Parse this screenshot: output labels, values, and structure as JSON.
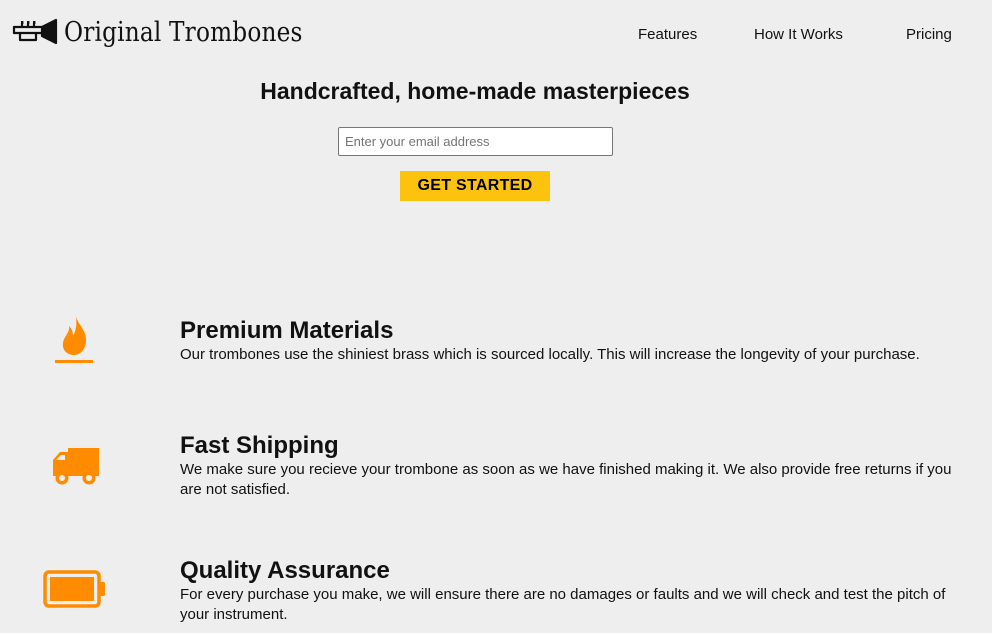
{
  "brand": {
    "name": "Original Trombones",
    "logo_icon": "trombone-icon"
  },
  "nav": {
    "items": [
      {
        "label": "Features"
      },
      {
        "label": "How It Works"
      },
      {
        "label": "Pricing"
      }
    ]
  },
  "hero": {
    "title": "Handcrafted, home-made masterpieces",
    "email_placeholder": "Enter your email address",
    "email_value": "",
    "cta_label": "GET STARTED"
  },
  "features": [
    {
      "icon": "fire-icon",
      "title": "Premium Materials",
      "description": "Our trombones use the shiniest brass which is sourced locally. This will increase the longevity of your purchase."
    },
    {
      "icon": "truck-icon",
      "title": "Fast Shipping",
      "description": "We make sure you recieve your trombone as soon as we have finished making it. We also provide free returns if you are not satisfied."
    },
    {
      "icon": "battery-full-icon",
      "title": "Quality Assurance",
      "description": "For every purchase you make, we will ensure there are no damages or faults and we will check and test the pitch of your instrument."
    }
  ],
  "colors": {
    "background": "#eeeeee",
    "accent_orange": "#ff8c00",
    "button_yellow": "#fbc30e",
    "text": "#111111"
  }
}
